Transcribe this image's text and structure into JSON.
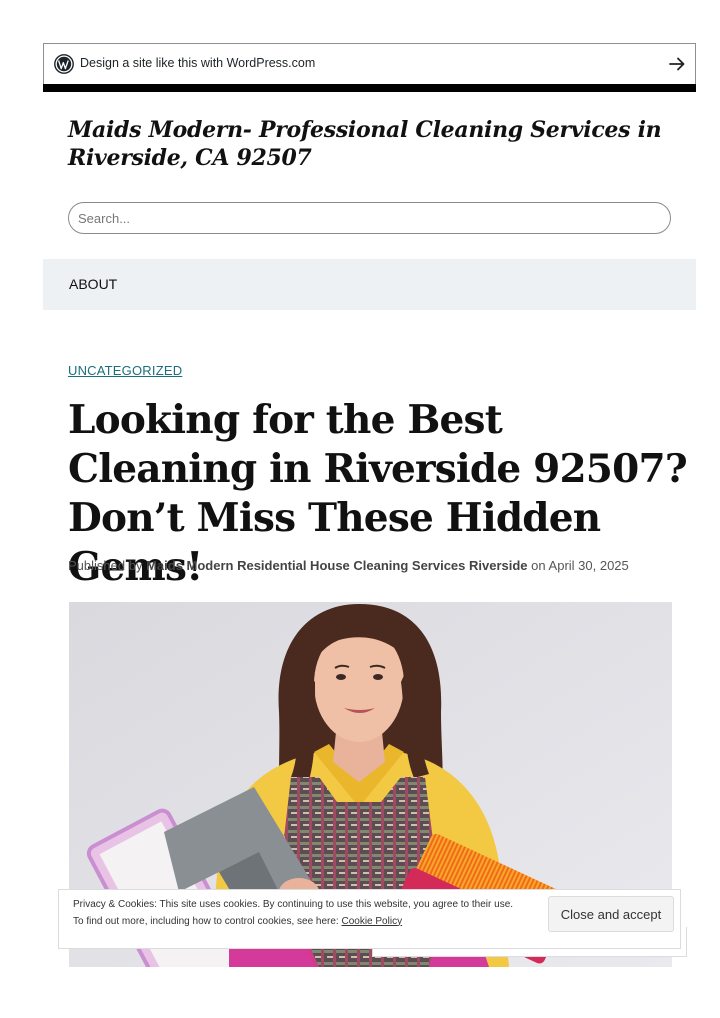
{
  "wp_banner": {
    "text": "Design a site like this with WordPress.com",
    "logo_icon": "wordpress-logo-icon",
    "arrow_icon": "arrow-right-icon"
  },
  "site": {
    "title": "Maids Modern- Professional Cleaning Services in Riverside, CA 92507"
  },
  "search": {
    "placeholder": "Search..."
  },
  "nav": {
    "items": [
      {
        "label": "ABOUT"
      }
    ]
  },
  "post": {
    "category": "UNCATEGORIZED",
    "title": "Looking for the Best Cleaning in Riverside 92507? Don’t Miss These Hidden Gems!",
    "meta": {
      "published_by": "Published by",
      "author": "Maids Modern Residential House Cleaning Services Riverside",
      "on": "on",
      "date": "April 30, 2025"
    }
  },
  "cookie_notice": {
    "line1": "Privacy & Cookies: This site uses cookies. By continuing to use this website, you agree to their use.",
    "line2_prefix": "To find out more, including how to control cookies, see here:",
    "link": "Cookie Policy",
    "button": "Close and accept"
  },
  "colors": {
    "category_link": "#1b6e7a",
    "nav_background": "#edf1f4"
  }
}
